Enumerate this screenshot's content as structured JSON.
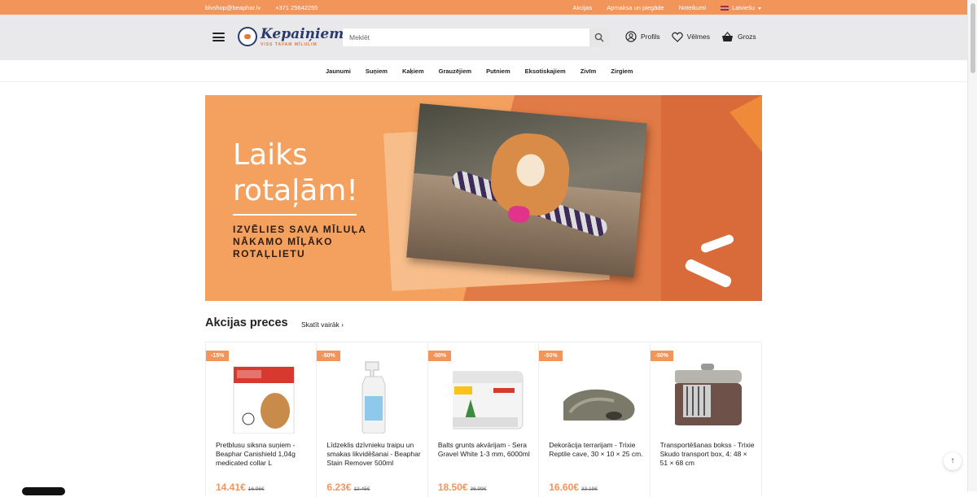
{
  "topbar": {
    "email": "blvshop@beaphar.lv",
    "phone": "+371 25642255",
    "links": [
      "Akcijas",
      "Apmaksa un piegāde",
      "Noteikumi"
    ],
    "language": "Latviešu"
  },
  "header": {
    "logo_text": "Kepaiņiem",
    "logo_tagline": "VISS TAVAM MĪLULIM",
    "search_placeholder": "Meklēt",
    "profile_label": "Profils",
    "wishlist_label": "Vēlmes",
    "cart_label": "Grozs"
  },
  "nav": {
    "items": [
      "Jaunumi",
      "Suņiem",
      "Kaķiem",
      "Grauzējiem",
      "Putniem",
      "Eksotiskajiem",
      "Zivīm",
      "Zirgiem"
    ]
  },
  "banner": {
    "headline_1": "Laiks",
    "headline_2": "rotaļām!",
    "subline": "IZVĒLIES SAVA MĪLUĻA NĀKAMO MĪĻĀKO ROTAĻLIETU"
  },
  "deals": {
    "title": "Akcijas preces",
    "see_more": "Skatīt vairāk",
    "products": [
      {
        "discount": "-15%",
        "name": "Pretblusu siksna suņiem - Beaphar Canishield 1,04g medicated collar L",
        "price": "14.41€",
        "old_price": "16.96€"
      },
      {
        "discount": "-50%",
        "name": "Līdzeklis dzīvnieku traipu un smakas likvidēšanai - Beaphar Stain Remover 500ml",
        "price": "6.23€",
        "old_price": "12.45€"
      },
      {
        "discount": "-50%",
        "name": "Balts grunts akvārijam - Sera Gravel White 1-3 mm, 6000ml",
        "price": "18.50€",
        "old_price": "36.99€"
      },
      {
        "discount": "-50%",
        "name": "Dekorācija terrarijam - Trixie Reptile cave, 30 × 10 × 25 cm.",
        "price": "16.60€",
        "old_price": "33.19€"
      },
      {
        "discount": "-50%",
        "name": "Transportēšanas bokss - Trixie Skudo transport box, 4: 48 × 51 × 68 cm",
        "price": "",
        "old_price": ""
      }
    ]
  },
  "colors": {
    "accent": "#f2955a",
    "header_bg": "#e9e9eb",
    "logo_navy": "#2a3a6a"
  }
}
